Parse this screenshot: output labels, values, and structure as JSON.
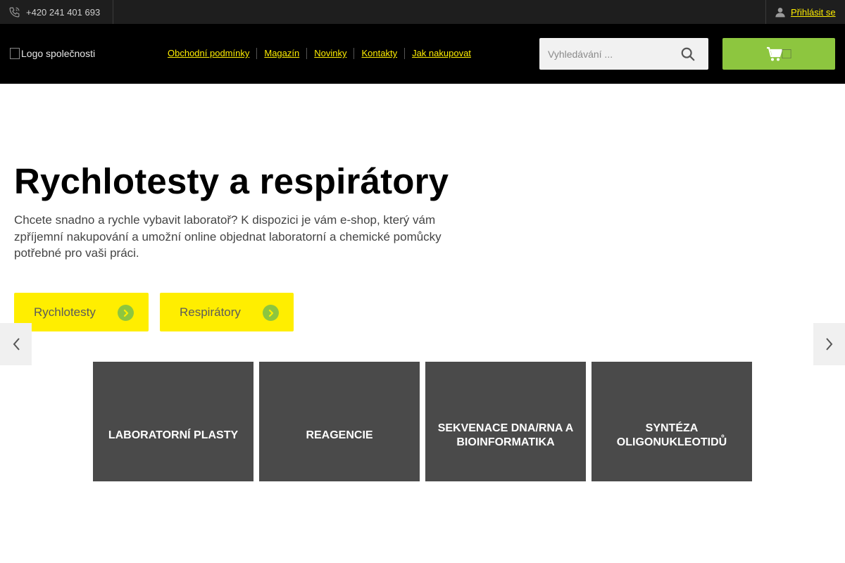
{
  "topbar": {
    "phone": "+420 241 401 693",
    "login_label": "Přihlásit se"
  },
  "header": {
    "logo_alt": "Logo společnosti",
    "nav": [
      {
        "label": "Obchodní podmínky"
      },
      {
        "label": "Magazín"
      },
      {
        "label": "Novinky"
      },
      {
        "label": "Kontakty"
      },
      {
        "label": "Jak nakupovat"
      }
    ],
    "search": {
      "placeholder": "Vyhledávání ..."
    },
    "cart": {
      "icon": "cart-icon",
      "count_glyph": "⃞"
    }
  },
  "hero": {
    "title": "Rychlotesty a respirátory",
    "text": "Chcete snadno a rychle vybavit laboratoř? K dispozici je vám e-shop, který vám zpříjemní nakupování a umožní online objednat laboratorní a chemické pomůcky potřebné pro vaši práci.",
    "buttons": [
      {
        "label": "Rychlotesty"
      },
      {
        "label": "Respirátory"
      }
    ]
  },
  "categories": [
    {
      "label": "Laboratorní plasty"
    },
    {
      "label": "Reagencie"
    },
    {
      "label": "Sekvenace DNA/RNA a bioinformatika"
    },
    {
      "label": "Syntéza oligonukleotidů"
    }
  ],
  "colors": {
    "accent_yellow": "#ffee00",
    "accent_green": "#8dc63f",
    "header_bg": "#000000",
    "tile_bg": "#4a4a4a"
  }
}
